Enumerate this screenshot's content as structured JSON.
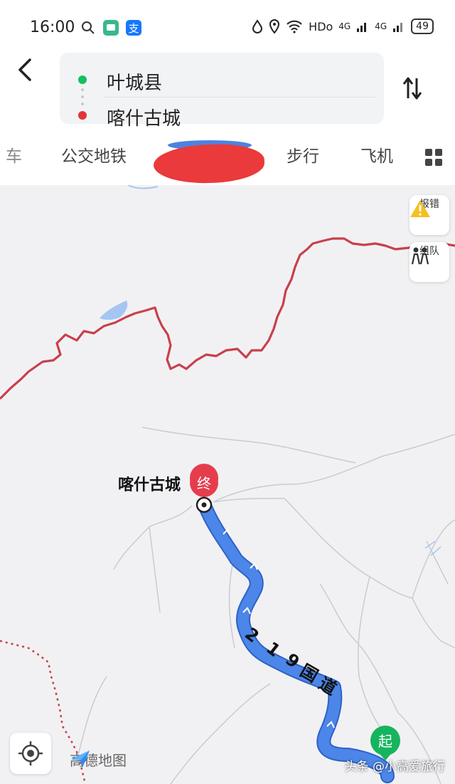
{
  "status_bar": {
    "time": "16:00",
    "network": "HDo",
    "cell1": "4G",
    "cell2": "4G",
    "battery": "49"
  },
  "route": {
    "start": "叶城县",
    "end": "喀什古城"
  },
  "tabs": [
    {
      "label": "车"
    },
    {
      "label": "公交地铁"
    },
    {
      "label": "步行"
    },
    {
      "label": "飞机"
    }
  ],
  "map": {
    "side_buttons": {
      "report_label": "报错",
      "team_label": "组队"
    },
    "end_marker": "终",
    "start_marker": "起",
    "destination_label": "喀什古城",
    "road_label_chars": [
      "2",
      "1",
      "9",
      "国",
      "道"
    ],
    "brand": "高德地图",
    "watermark": "头条 @小高爱旅行"
  },
  "colors": {
    "route_blue": "#4b86e8",
    "border_red": "#c8404b",
    "start_green": "#16b45e",
    "end_red": "#e63d4d"
  }
}
